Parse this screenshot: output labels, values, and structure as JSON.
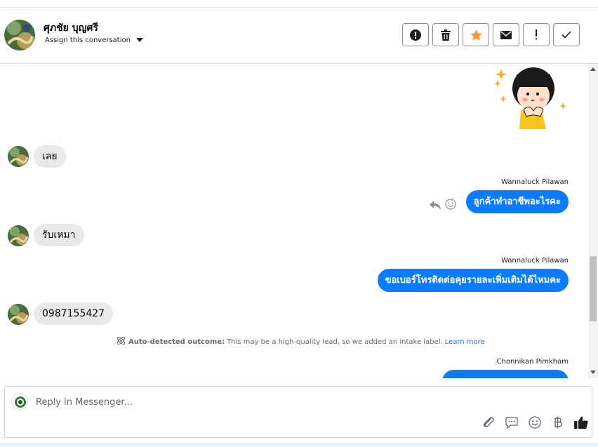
{
  "header": {
    "contact_name": "ศุภชัย บุญศรี",
    "assign_label": "Assign this conversation",
    "actions": [
      {
        "name": "report-spam-button",
        "icon": "alert-circle-icon"
      },
      {
        "name": "delete-button",
        "icon": "trash-icon"
      },
      {
        "name": "star-button",
        "icon": "star-icon"
      },
      {
        "name": "mark-unread-button",
        "icon": "envelope-icon"
      },
      {
        "name": "follow-up-button",
        "icon": "exclamation-icon"
      },
      {
        "name": "mark-done-button",
        "icon": "checkmark-icon"
      }
    ]
  },
  "thread": {
    "messages": [
      {
        "direction": "in",
        "text": "เลย"
      },
      {
        "direction": "out",
        "sender": "Wannaluck Pilawan",
        "text": "ลูกค้าทำอาชีพอะไรคะ"
      },
      {
        "direction": "in",
        "text": "รับเหมา"
      },
      {
        "direction": "out",
        "sender": "Wannaluck Pilawan",
        "text": "ขอเบอร์โทรติดต่อคุยรายละเพิ่มเติมได้ไหมคะ"
      },
      {
        "direction": "in",
        "text": "0987155427"
      },
      {
        "direction": "out",
        "sender": "Chonnikan Pimkham",
        "text": ""
      }
    ],
    "outcome": {
      "label": "Auto-detected outcome:",
      "text": "This may be a high-quality lead, so we added an intake label.",
      "link": "Learn more"
    }
  },
  "composer": {
    "placeholder": "Reply in Messenger...",
    "tools": [
      "paperclip-icon",
      "saved-reply-icon",
      "emoji-icon",
      "baht-icon",
      "thumbs-up-icon"
    ]
  },
  "colors": {
    "outgoing_bubble": "#0a7cff",
    "incoming_bubble": "#e9e9eb",
    "star": "#f5923e",
    "link": "#216fdb"
  }
}
